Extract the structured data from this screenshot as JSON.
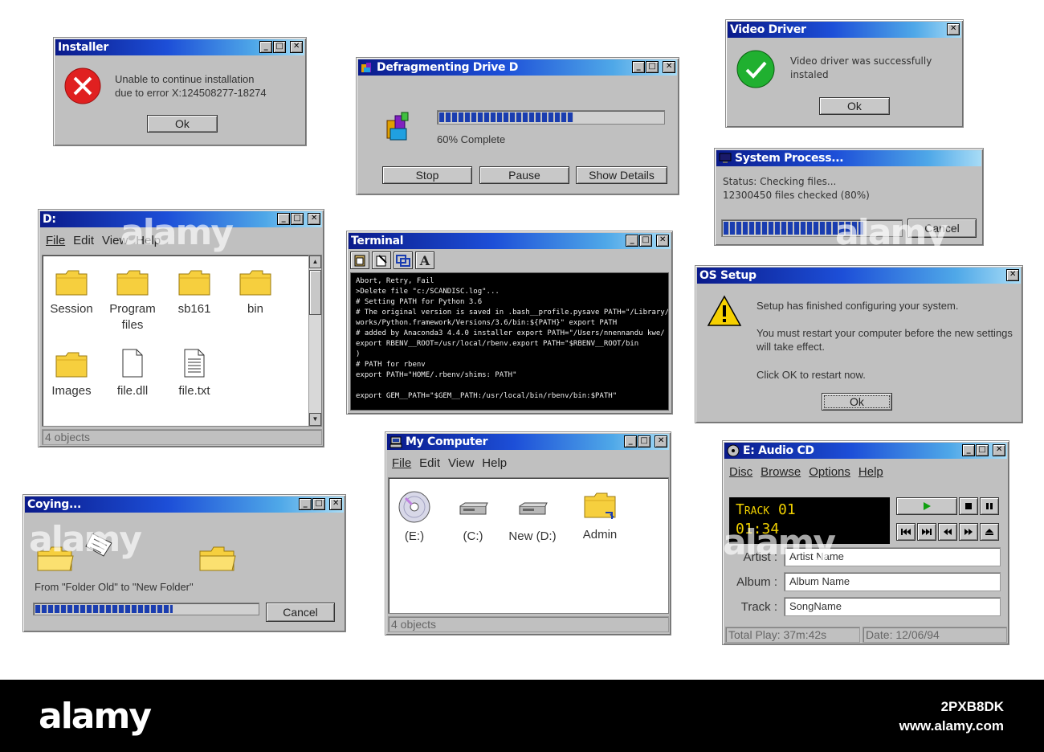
{
  "installer": {
    "title": "Installer",
    "line1": "Unable to continue installation",
    "line2": "due to error  X:124508277-18274",
    "ok": "Ok"
  },
  "defrag": {
    "title": "Defragmenting Drive D",
    "progress_pct": 60,
    "status": "60% Complete",
    "stop": "Stop",
    "pause": "Pause",
    "details": "Show Details"
  },
  "video": {
    "title": "Video Driver",
    "line1": "Video driver was successfully",
    "line2": "instaled",
    "ok": "Ok"
  },
  "sysproc": {
    "title": "System Process...",
    "status": "Status: Checking files...",
    "files": "12300450 files checked (80%)",
    "progress_pct": 80,
    "cancel": "Cancel"
  },
  "drive_d": {
    "title": "D:",
    "menu": [
      "File",
      "Edit",
      "View",
      "Help"
    ],
    "items": [
      {
        "label": "Session",
        "icon": "folder-icon"
      },
      {
        "label": "Program files",
        "icon": "folder-icon"
      },
      {
        "label": "sb161",
        "icon": "folder-icon"
      },
      {
        "label": "bin",
        "icon": "folder-icon"
      },
      {
        "label": "Images",
        "icon": "folder-icon"
      },
      {
        "label": "file.dll",
        "icon": "file-icon"
      },
      {
        "label": "file.txt",
        "icon": "text-file-icon"
      }
    ],
    "status": "4 objects"
  },
  "terminal": {
    "title": "Terminal",
    "lines": [
      "Abort, Retry, Fail",
      ">Delete file \"c:/SCANDISC.log\"...",
      "# Setting PATH for Python 3.6",
      "# The original version is saved in .bash__profile.pysave PATH=\"/Library/Frame",
      "works/Python.framework/Versions/3.6/bin:${PATH}\" export PATH",
      "# added by Anaconda3 4.4.0 installer export PATH=\"/Users/nnennandu kwe/",
      "export RBENV__ROOT=/usr/local/rbenv.export PATH=\"$RBENV__ROOT/bin",
      ")",
      "# PATH for rbenv",
      "export PATH=\"HOME/.rbenv/shims: PATH\"",
      "",
      "export GEM__PATH=\"$GEM__PATH:/usr/local/bin/rbenv/bin:$PATH\""
    ]
  },
  "os_setup": {
    "title": "OS Setup",
    "line1": "Setup has finished configuring your system.",
    "line2": "You must restart your computer before the new settings",
    "line3": "will take effect.",
    "line4": "Click OK to restart  now.",
    "ok": "Ok"
  },
  "copying": {
    "title": "Coying...",
    "text": "From \"Folder Old\" to \"New Folder\"",
    "progress_pct": 62,
    "cancel": "Cancel"
  },
  "my_computer": {
    "title": "My Computer",
    "menu": [
      "File",
      "Edit",
      "View",
      "Help"
    ],
    "items": [
      {
        "label": "(E:)",
        "icon": "cd-drive-icon"
      },
      {
        "label": "(C:)",
        "icon": "hard-drive-icon"
      },
      {
        "label": "New (D:)",
        "icon": "hard-drive-icon"
      },
      {
        "label": "Admin",
        "icon": "shared-folder-icon"
      }
    ],
    "status": "4 objects"
  },
  "audio_cd": {
    "title": "E: Audio CD",
    "menu": [
      "Disc",
      "Browse",
      "Options",
      "Help"
    ],
    "track_display": "Track 01",
    "time_display": "01:34",
    "artist_label": "Artist :",
    "artist_value": "Artist Name",
    "album_label": "Album :",
    "album_value": "Album Name",
    "track_label": "Track :",
    "track_value": "SongName",
    "total_play": "Total Play: 37m:42s",
    "date": "Date: 12/06/94"
  },
  "footer": {
    "logo": "alamy",
    "code": "2PXB8DK",
    "url": "www.alamy.com"
  },
  "watermark": "alamy",
  "colors": {
    "title_start": "#0a1a8a",
    "title_end": "#a8dcf6",
    "progress": "#1a3db0",
    "window_bg": "#c0c0c0",
    "lcd_text": "#f0d000"
  }
}
